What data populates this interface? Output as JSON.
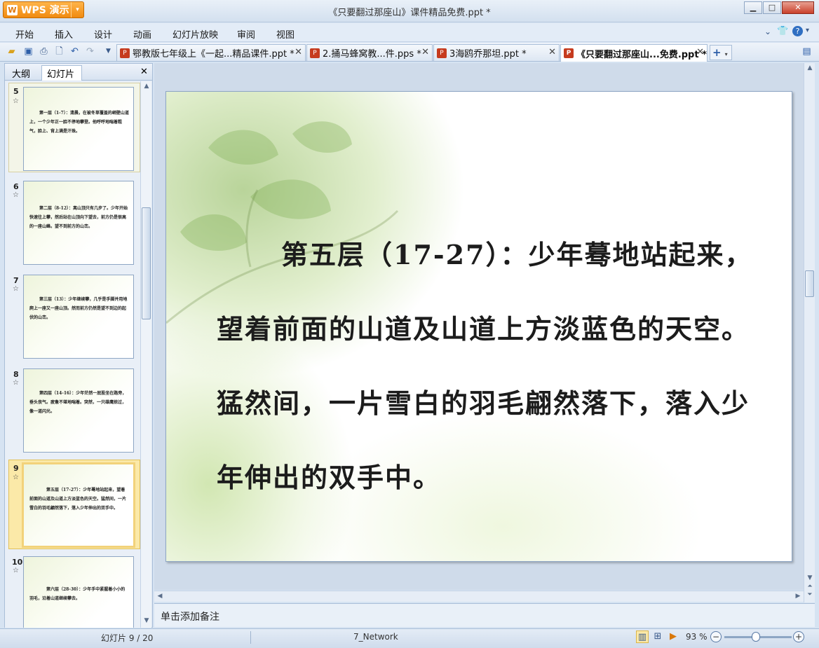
{
  "window": {
    "app_button": "WPS 演示",
    "title": "《只要翻过那座山》课件精品免费.ppt *"
  },
  "menu": {
    "items": [
      "开始",
      "插入",
      "设计",
      "动画",
      "幻灯片放映",
      "审阅",
      "视图"
    ]
  },
  "toolbar": {
    "icons": [
      "open-folder-icon",
      "save-icon",
      "print-icon",
      "print-preview-icon",
      "undo-icon",
      "redo-icon",
      "dropdown-icon"
    ]
  },
  "doc_tabs": [
    {
      "title": "鄂教版七年级上《一起...精品课件.ppt *",
      "active": false
    },
    {
      "title": "2.捅马蜂窝教...件.pps *",
      "active": false
    },
    {
      "title": "3海鸥乔那坦.ppt *",
      "active": false
    },
    {
      "title": "《只要翻过那座山...免费.ppt *",
      "active": true
    }
  ],
  "left_pane": {
    "tabs": [
      "大纲",
      "幻灯片"
    ],
    "active_tab": "幻灯片",
    "thumbnails": [
      {
        "number": "5",
        "text": "第一层（1-7）：清晨，在被冬草覆盖的峭壁山道上，一个少年正一脸不停地攀登。他呼呼地喘着粗气，脸上、背上满是汗珠。"
      },
      {
        "number": "6",
        "text": "第二层（8-12）：离山顶只有几步了。少年开始快速往上攀，然后站在山顶向下望去，前方仍是很高的一座山峰。望不到前方的山峦。"
      },
      {
        "number": "7",
        "text": "第三层（13）：少年继续攀，几乎是手脚并用地爬上一座又一座山顶。然而前方仍然是望不到边的起伏的山峦。"
      },
      {
        "number": "8",
        "text": "第四层（14-16）：少年茫然一屁股坐在路旁，垂头丧气。疲惫不堪地喘着。突然，一只雄鹰掠过，像一道闪光。"
      },
      {
        "number": "9",
        "text": "第五层（17-27）：少年蓦地站起来，望着前面的山道及山道上方淡蓝色的天空。猛然间，一片雪白的羽毛翩然落下，落入少年伸出的双手中。",
        "selected": true
      },
      {
        "number": "10",
        "text": "第六层（28-30）：少年手中紧握着小小的羽毛，沿着山道继续攀去。"
      }
    ]
  },
  "slide": {
    "text": "第五层（17-27）：少年蓦地站起来，望着前面的山道及山道上方淡蓝色的天空。猛然间，一片雪白的羽毛翩然落下，落入少年伸出的双手中。"
  },
  "notes_placeholder": "单击添加备注",
  "status": {
    "slide_counter": "幻灯片 9 / 20",
    "theme": "7_Network",
    "zoom": "93 %",
    "zoom_fraction": 0.47
  }
}
